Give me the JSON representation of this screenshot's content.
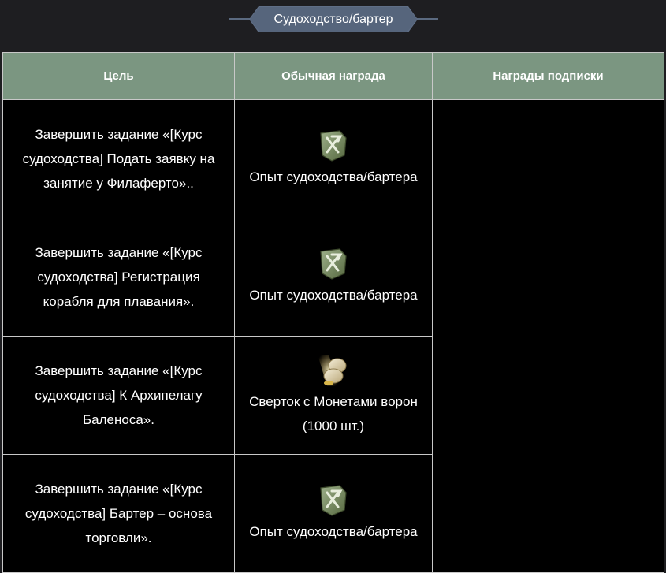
{
  "header": {
    "title": "Судоходство/бартер"
  },
  "table": {
    "columns": [
      "Цель",
      "Обычная награда",
      "Награды подписки"
    ],
    "rows": [
      {
        "goal": "Завершить задание «[Курс судоходства] Подать заявку на занятие у Филаферто»..",
        "reward": "Опыт судоходства/бартера",
        "reward_icon": "sailing-trade-xp-icon"
      },
      {
        "goal": "Завершить задание «[Курс судоходства] Регистрация корабля для плавания».",
        "reward": "Опыт судоходства/бартера",
        "reward_icon": "sailing-trade-xp-icon"
      },
      {
        "goal": "Завершить задание «[Курс судоходства] К Архипелагу Баленоса».",
        "reward": "Сверток с Монетами ворон (1000 шт.)",
        "reward_icon": "crow-coin-pouch-icon"
      },
      {
        "goal": "Завершить задание «[Курс судоходства] Бартер – основа торговли».",
        "reward": "Опыт судоходства/бартера",
        "reward_icon": "sailing-trade-xp-icon"
      }
    ]
  },
  "colors": {
    "page_background": "#1e1e21",
    "header_tab": "#56657c",
    "table_header": "#7b9681",
    "cell_background": "#000000",
    "border": "#c8c8c8"
  }
}
